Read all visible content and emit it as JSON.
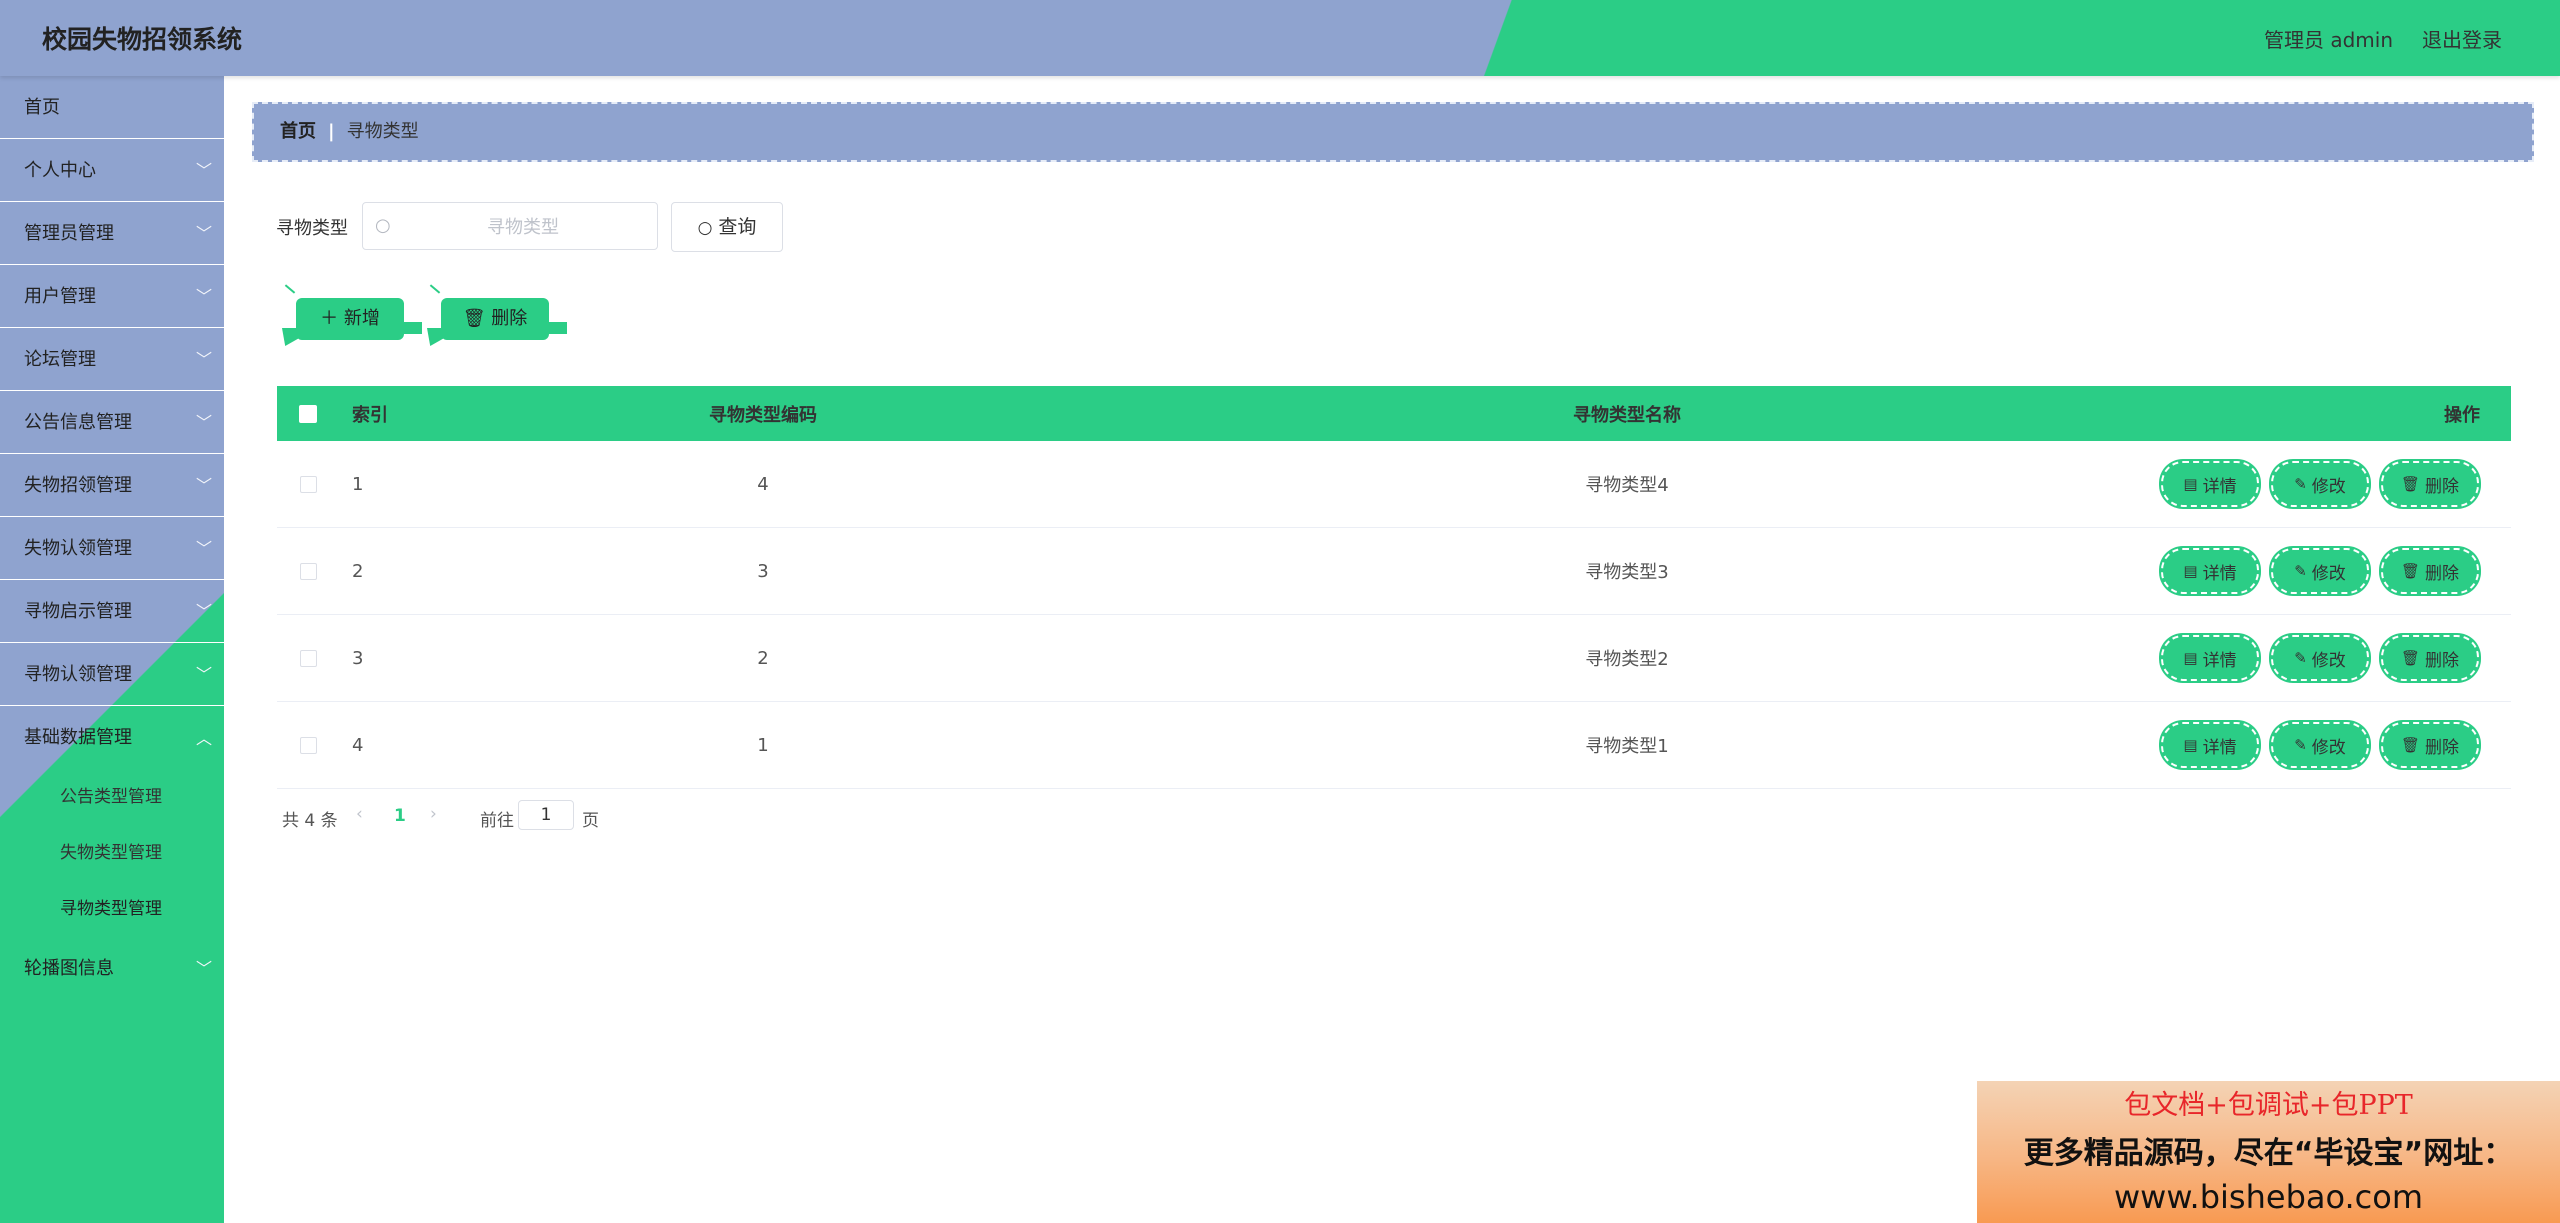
{
  "header": {
    "title": "校园失物招领系统",
    "user": "管理员 admin",
    "logout": "退出登录"
  },
  "colors": {
    "accent": "#2bcd86",
    "primary": "#8fa3cf"
  },
  "sidebar": {
    "items": [
      {
        "label": "首页"
      },
      {
        "label": "个人中心"
      },
      {
        "label": "管理员管理"
      },
      {
        "label": "用户管理"
      },
      {
        "label": "论坛管理"
      },
      {
        "label": "公告信息管理"
      },
      {
        "label": "失物招领管理"
      },
      {
        "label": "失物认领管理"
      },
      {
        "label": "寻物启示管理"
      },
      {
        "label": "寻物认领管理"
      },
      {
        "label": "基础数据管理"
      },
      {
        "label": "轮播图信息"
      }
    ],
    "submenu": [
      {
        "label": "公告类型管理"
      },
      {
        "label": "失物类型管理"
      },
      {
        "label": "寻物类型管理"
      }
    ]
  },
  "breadcrumb": {
    "home": "首页",
    "separator": "|",
    "current": "寻物类型"
  },
  "search": {
    "label": "寻物类型",
    "placeholder": "寻物类型",
    "value": "",
    "button": "查询"
  },
  "actions": {
    "add": "新增",
    "delete": "删除"
  },
  "table": {
    "headers": {
      "index": "索引",
      "code": "寻物类型编码",
      "name": "寻物类型名称",
      "ops": "操作"
    },
    "rows": [
      {
        "index": "1",
        "code": "4",
        "name": "寻物类型4"
      },
      {
        "index": "2",
        "code": "3",
        "name": "寻物类型3"
      },
      {
        "index": "3",
        "code": "2",
        "name": "寻物类型2"
      },
      {
        "index": "4",
        "code": "1",
        "name": "寻物类型1"
      }
    ],
    "row_buttons": {
      "detail": "详情",
      "edit": "修改",
      "delete": "删除"
    }
  },
  "pagination": {
    "total": "共 4 条",
    "prev": "‹",
    "current_page": "1",
    "next": "›",
    "goto": "前往",
    "page_input": "1",
    "page_suffix": "页"
  },
  "ad": {
    "line1": "包文档+包调试+包PPT",
    "line2": "更多精品源码，尽在“毕设宝”网址：",
    "line3": "www.bishebao.com"
  }
}
